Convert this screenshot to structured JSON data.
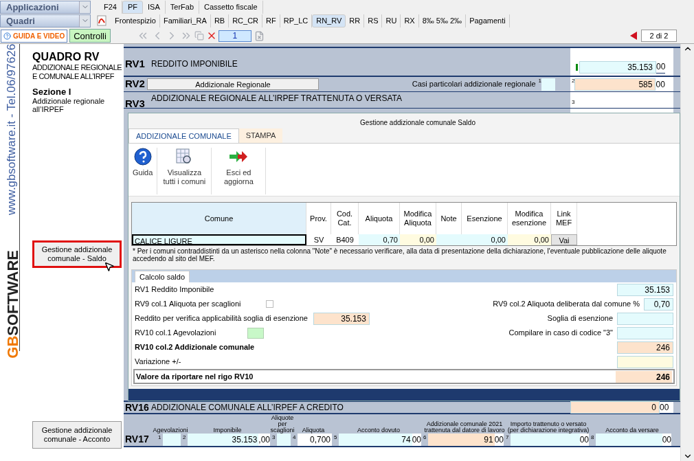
{
  "app_menu": {
    "label": "Applicazioni"
  },
  "top_tabs": [
    {
      "label": "F24",
      "selected": false
    },
    {
      "label": "PF",
      "selected": true
    },
    {
      "label": "ISA",
      "selected": false
    },
    {
      "label": "TerFab",
      "selected": false
    },
    {
      "label": "Cassetto fiscale",
      "selected": false
    }
  ],
  "quadri_menu": {
    "label": "Quadri"
  },
  "quadri_tabs": [
    {
      "label": "Frontespizio",
      "selected": false
    },
    {
      "label": "Familiari_RA",
      "selected": false
    },
    {
      "label": "RB",
      "selected": false
    },
    {
      "label": "RC_CR",
      "selected": false
    },
    {
      "label": "RF",
      "selected": false
    },
    {
      "label": "RP_LC",
      "selected": false
    },
    {
      "label": "RN_RV",
      "selected": true
    },
    {
      "label": "RR",
      "selected": false
    },
    {
      "label": "RS",
      "selected": false
    },
    {
      "label": "RU",
      "selected": false
    },
    {
      "label": "RX",
      "selected": false
    },
    {
      "label": "8‰ 5‰ 2‰",
      "selected": false
    },
    {
      "label": "Pagamenti",
      "selected": false
    }
  ],
  "toolbar": {
    "guide_button": "GUIDA E VIDEO",
    "check_button": "Controlli",
    "page": "1",
    "page_count": "2 di 2"
  },
  "sidebar": {
    "vertical_text": "www.gbsoftware.it - Tel.06/97626",
    "logo_initials": "GB",
    "logo": "SOFTWARE",
    "title": "QUADRO RV",
    "subtitle": "ADDIZIONALE REGIONALE E COMUNALE ALL’IRPEF",
    "section": "Sezione I",
    "section_text": "Addizionale regionale all’IRPEF",
    "buttons": [
      {
        "label": "Gestione addizionale comunale - Saldo",
        "highlighted": true
      },
      {
        "label": "Gestione addizionale comunale - Acconto",
        "highlighted": false
      }
    ]
  },
  "form": {
    "rv1": {
      "code": "RV1",
      "label": "REDDITO IMPONIBILE",
      "value": "35.153",
      "decimals": "00"
    },
    "rv2": {
      "code": "RV2",
      "button": "Addizionale Regionale",
      "label": "Casi particolari addizionale regionale",
      "index_1": "1",
      "index_2": "2",
      "value": "585",
      "decimals": "00"
    },
    "rv3": {
      "code": "RV3",
      "label": "ADDIZIONALE REGIONALE ALL’IRPEF TRATTENUTA O VERSATA",
      "index": "3"
    },
    "rv16": {
      "code": "RV16",
      "label": "ADDIZIONALE COMUNALE ALL’IRPEF A CREDITO",
      "value": "0",
      "decimals": "00"
    },
    "rv17": {
      "code": "RV17",
      "columns": [
        {
          "label": "Agevolazioni",
          "index": "1",
          "kind": "input"
        },
        {
          "label": "Imponibile",
          "index": "2",
          "kind": "input",
          "value": "35.153",
          "decimals": ",00"
        },
        {
          "label": "Aliquote per scaglioni",
          "index": "3",
          "kind": "input"
        },
        {
          "label": "Aliquota",
          "index": "4",
          "kind": "plain",
          "value": "0,700"
        },
        {
          "label": "Acconto dovuto",
          "index": "5",
          "kind": "input",
          "value": "74",
          "decimals": "00"
        },
        {
          "label": "Addizionale comunale 2021 trattenuta dal datore di lavoro",
          "index": "6",
          "kind": "computed",
          "value": "91",
          "decimals": "00"
        },
        {
          "label": "Importo trattenuto o versato (per dichiarazione integrativa)",
          "index": "7",
          "kind": "input",
          "decimals": "00"
        },
        {
          "label": "Acconto da versare",
          "index": "8",
          "kind": "input",
          "decimals": "00"
        }
      ]
    }
  },
  "dialog": {
    "title": "Gestione addizionale comunale Saldo",
    "tabs": [
      {
        "label": "ADDIZIONALE COMUNALE",
        "selected": true
      },
      {
        "label": "STAMPA",
        "selected": false
      }
    ],
    "ribbon": [
      {
        "kind": "help",
        "label": "Guida"
      },
      {
        "kind": "list",
        "label": "Visualizza tutti i comuni"
      },
      {
        "kind": "exit",
        "label": "Esci ed aggiorna"
      }
    ],
    "table": {
      "columns": [
        "Comune",
        "Prov.",
        "Cod. Cat.",
        "Aliquota",
        "Modifica Aliquota",
        "Note",
        "Esenzione",
        "Modifica esenzione",
        "Link MEF"
      ],
      "rows": [
        {
          "selected": true,
          "cells": [
            {
              "kind": "input",
              "value": "CALICE LIGURE"
            },
            {
              "kind": "text",
              "value": "SV"
            },
            {
              "kind": "text",
              "value": "B409"
            },
            {
              "kind": "input",
              "value": "0,70"
            },
            {
              "kind": "editable",
              "value": "0,00"
            },
            {
              "kind": "input"
            },
            {
              "kind": "input",
              "value": "0,00"
            },
            {
              "kind": "editable",
              "value": "0,00"
            },
            {
              "kind": "link",
              "value": "Vai"
            }
          ]
        }
      ]
    },
    "note": "* Per i comuni contraddistinti da un asterisco nella colonna \"Note\" è necessario verificare,  alla data di presentazione della dichiarazione, l'eventuale pubblicazione delle aliquote accedendo al sito del MEF.",
    "calc_tab": "Calcolo saldo",
    "calc_rows": [
      {
        "label": "RV1 Reddito Imponibile",
        "bold": false,
        "right": {
          "field": {
            "kind": "input",
            "value": "35.153"
          }
        }
      },
      {
        "label": "RV9 col.1 Aliquota per scaglioni",
        "bold": false,
        "checkbox": {
          "checked": false
        },
        "right": {
          "label": "RV9 col.2 Aliquota deliberata dal comune %",
          "field": {
            "kind": "input",
            "value": "0,70",
            "small": true
          }
        }
      },
      {
        "label": "Reddito per verifica applicabilità soglia di esenzione",
        "bold": false,
        "field": {
          "kind": "computed",
          "value": "35.153"
        },
        "right": {
          "label": "Soglia di esenzione",
          "field": {
            "kind": "input"
          }
        }
      },
      {
        "label": "RV10 col.1 Agevolazioni",
        "bold": false,
        "flag": {
          "kind": "flag"
        },
        "right": {
          "label": "Compilare in caso di codice \"3\"",
          "field": {
            "kind": "input"
          }
        }
      },
      {
        "label": "RV10 col.2 Addizionale comunale",
        "bold": true,
        "right": {
          "field": {
            "kind": "computed",
            "value": "246"
          }
        }
      },
      {
        "label": "Variazione +/-",
        "bold": false,
        "right": {
          "field": {
            "kind": "editable"
          }
        }
      }
    ],
    "total": {
      "label": "Valore da riportare nel rigo RV10",
      "value": "246"
    }
  }
}
